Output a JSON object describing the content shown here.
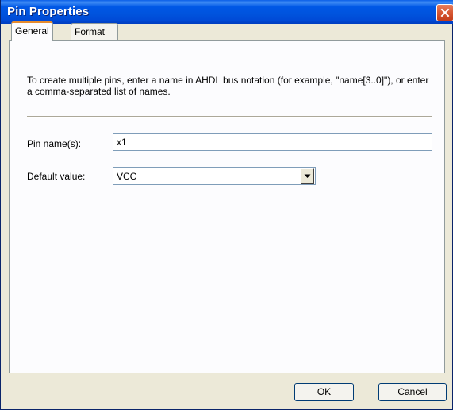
{
  "window": {
    "title": "Pin Properties",
    "close_icon": "close-icon"
  },
  "tabs": [
    {
      "label": "General",
      "selected": true
    },
    {
      "label": "Format",
      "selected": false
    }
  ],
  "general": {
    "description": "To create multiple pins, enter a name in AHDL bus notation (for example, \"name[3..0]\"), or enter a comma-separated list of names.",
    "pin_name_label": "Pin name(s):",
    "pin_name_value": "x1",
    "default_value_label": "Default value:",
    "default_value_selected": "VCC"
  },
  "buttons": {
    "ok": "OK",
    "cancel": "Cancel"
  },
  "colors": {
    "titlebar": "#0055e5",
    "close_button": "#d85a36",
    "dialog_background": "#ece9d8",
    "tab_accent": "#e68b2c"
  }
}
